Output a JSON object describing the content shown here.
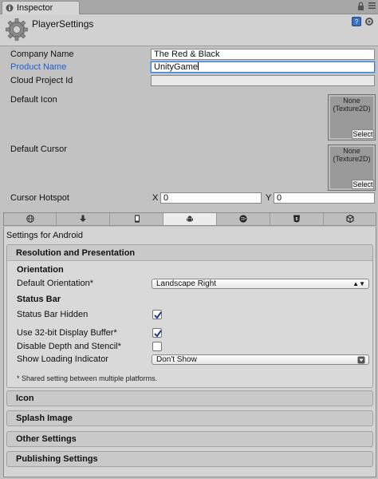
{
  "window": {
    "tab_title": "Inspector"
  },
  "header": {
    "title": "PlayerSettings"
  },
  "fields": {
    "company_name": {
      "label": "Company Name",
      "value": "The Red & Black"
    },
    "product_name": {
      "label": "Product Name",
      "value": "UnityGame"
    },
    "cloud_project_id": {
      "label": "Cloud Project Id",
      "value": ""
    },
    "default_icon": {
      "label": "Default Icon",
      "none_text": "None",
      "type_text": "(Texture2D)",
      "select_label": "Select"
    },
    "default_cursor": {
      "label": "Default Cursor",
      "none_text": "None",
      "type_text": "(Texture2D)",
      "select_label": "Select"
    },
    "cursor_hotspot": {
      "label": "Cursor Hotspot",
      "x_label": "X",
      "x_value": "0",
      "y_label": "Y",
      "y_value": "0"
    }
  },
  "platform_tabs": [
    {
      "icon": "globe-icon",
      "active": false
    },
    {
      "icon": "download-icon",
      "active": false
    },
    {
      "icon": "phone-icon",
      "active": false
    },
    {
      "icon": "android-icon",
      "active": true
    },
    {
      "icon": "blackberry-icon",
      "active": false
    },
    {
      "icon": "html5-icon",
      "active": false
    },
    {
      "icon": "unity-cube-icon",
      "active": false
    }
  ],
  "settings": {
    "title": "Settings for Android",
    "resolution": {
      "title": "Resolution and Presentation",
      "orientation_header": "Orientation",
      "default_orientation_label": "Default Orientation*",
      "default_orientation_value": "Landscape Right",
      "status_bar_header": "Status Bar",
      "status_bar_hidden_label": "Status Bar Hidden",
      "status_bar_hidden_checked": true,
      "use_32bit_label": "Use 32-bit Display Buffer*",
      "use_32bit_checked": true,
      "disable_depth_label": "Disable Depth and Stencil*",
      "disable_depth_checked": false,
      "loading_indicator_label": "Show Loading Indicator",
      "loading_indicator_value": "Don't Show",
      "note": "* Shared setting between multiple platforms."
    },
    "sections": [
      "Icon",
      "Splash Image",
      "Other Settings",
      "Publishing Settings"
    ]
  },
  "colors": {
    "accent_blue": "#1f5fd4",
    "background": "#c2c2c2"
  }
}
